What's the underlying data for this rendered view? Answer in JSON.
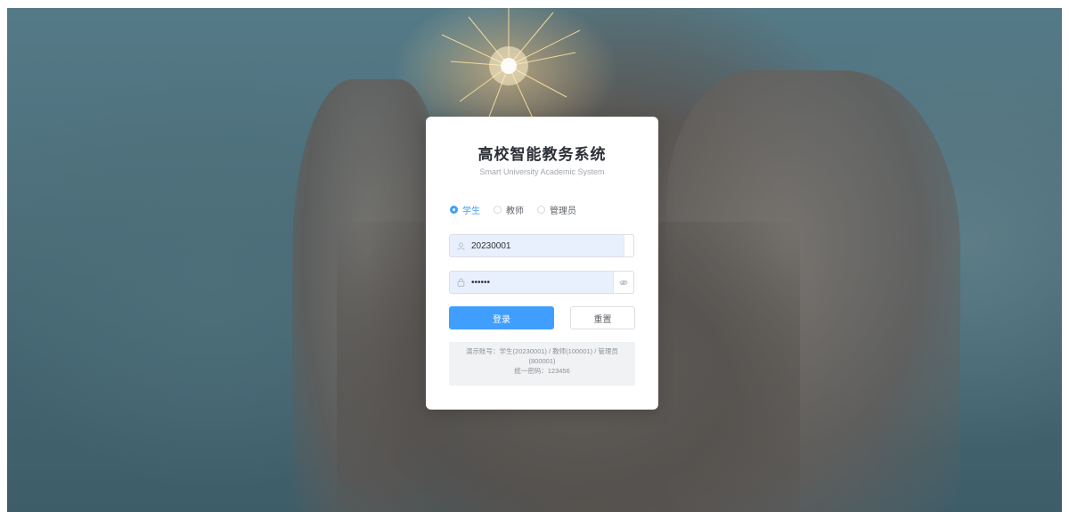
{
  "app": {
    "title": "高校智能教务系统",
    "subtitle": "Smart University Academic System"
  },
  "roles": [
    {
      "label": "学生",
      "selected": true
    },
    {
      "label": "教师",
      "selected": false
    },
    {
      "label": "管理员",
      "selected": false
    }
  ],
  "login_form": {
    "username_value": "20230001",
    "password_value": "123456",
    "login_label": "登录",
    "reset_label": "重置"
  },
  "demo_info": {
    "line1": "演示账号：学生(20230001) / 教师(100001) / 管理员",
    "line2": "(800001)",
    "line3": "统一密码：123456"
  },
  "icons": {
    "username": "user-icon",
    "password": "lock-icon",
    "toggle_password": "eye-icon"
  },
  "colors": {
    "accent": "#409eff",
    "input_autofill": "#e8f0fe"
  }
}
